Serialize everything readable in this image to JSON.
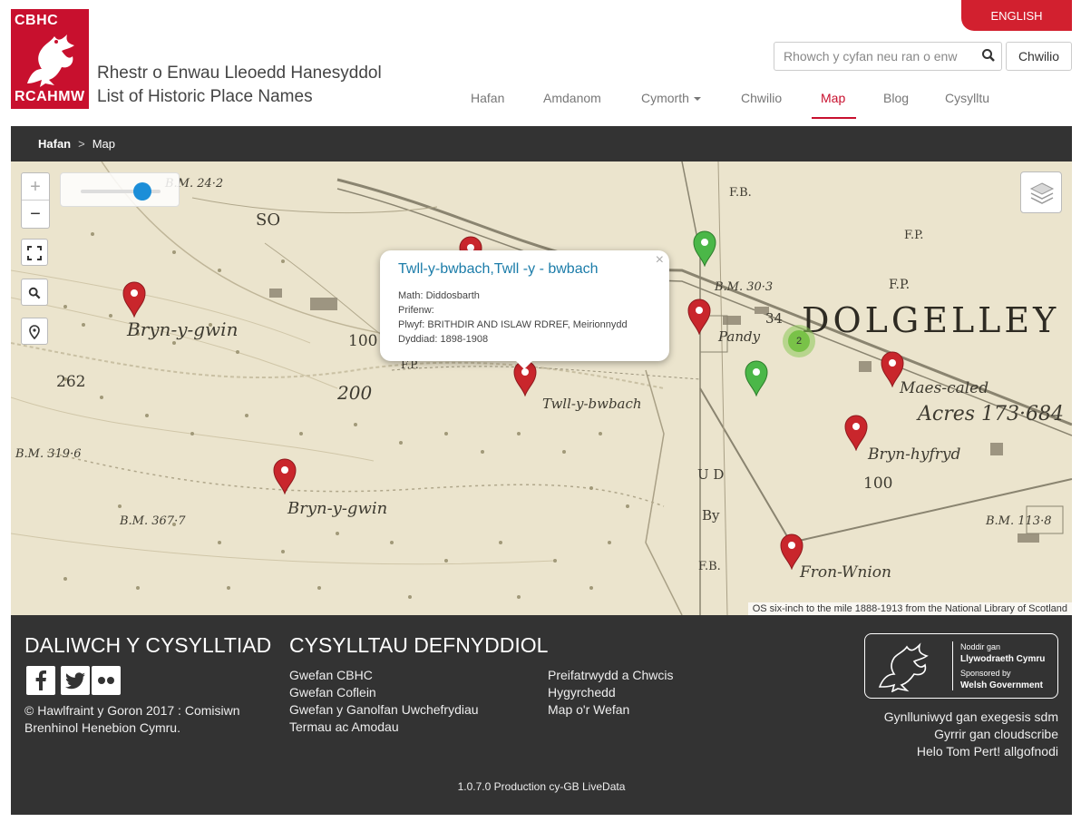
{
  "logo": {
    "top_text": "CBHC",
    "bottom_text": "RCAHMW"
  },
  "site_title": {
    "line1": "Rhestr o Enwau Lleoedd Hanesyddol",
    "line2": "List of Historic Place Names"
  },
  "language_button": "ENGLISH",
  "search": {
    "placeholder": "Rhowch y cyfan neu ran o enw",
    "button": "Chwilio"
  },
  "nav": {
    "items": [
      {
        "label": "Hafan",
        "active": false
      },
      {
        "label": "Amdanom",
        "active": false
      },
      {
        "label": "Cymorth",
        "active": false,
        "dropdown": true
      },
      {
        "label": "Chwilio",
        "active": false
      },
      {
        "label": "Map",
        "active": true
      },
      {
        "label": "Blog",
        "active": false
      },
      {
        "label": "Cysylltu",
        "active": false
      }
    ]
  },
  "breadcrumb": {
    "home": "Hafan",
    "separator": ">",
    "current": "Map"
  },
  "map": {
    "zoom_in": "+",
    "zoom_out": "−",
    "attribution": "OS six-inch to the mile 1888-1913 from the National Library of Scotland",
    "popup": {
      "title": "Twll-y-bwbach,Twll -y - bwbach",
      "close": "×",
      "rows": [
        "Math: Diddosbarth",
        "Prifenw:",
        "Plwyf: BRITHDIR AND ISLAW RDREF, Meirionnydd",
        "Dyddiad: 1898-1908"
      ]
    },
    "cluster_count": "2",
    "map_labels": {
      "bryn_y_gwin_1": "Bryn-y-gwin",
      "bryn_y_gwin_2": "Bryn-y-gwin",
      "twll_y_bwbach": "Twll-y-bwbach",
      "dolgelley": "DOLGELLEY",
      "maes_caled": "Maes-caled",
      "acres": "Acres 173·684",
      "bryn_hyfryd": "Bryn-hyfryd",
      "fron_wnion": "Fron-Wnion",
      "pandy": "Pandy",
      "bm_3193": "B.M. 319·6",
      "bm_3677": "B.M. 367·7",
      "bm_303": "B.M. 30·3",
      "bm_1133": "B.M. 113·8",
      "bm_242": "B.M. 24·2",
      "n262": "262",
      "n200": "200",
      "n100a": "100",
      "n100b": "100",
      "n34": "34",
      "fp1": "F.P.",
      "fp2": "F.P.",
      "fp3": "F.B.",
      "fp4": "F.B.",
      "fp5": "F.P.",
      "so": "SO",
      "ud": "U D",
      "by": "By"
    },
    "colors": {
      "red_marker": "#c9262c",
      "green_marker": "#4bb748"
    }
  },
  "footer": {
    "social_heading": "DALIWCH Y CYSYLLTIAD",
    "links_heading": "CYSYLLTAU DEFNYDDIOL",
    "copyright": "© Hawlfraint y Goron 2017 : Comisiwn Brenhinol Henebion Cymru.",
    "links_col1": [
      "Gwefan CBHC",
      "Gwefan Coflein",
      "Gwefan y Ganolfan Uwchefrydiau",
      "Termau ac Amodau"
    ],
    "links_col2": [
      "Preifatrwydd a Chwcis",
      "Hygyrchedd",
      "Map o'r Wefan"
    ],
    "gov_badge": {
      "line1": "Noddir gan",
      "line2": "Llywodraeth Cymru",
      "line3": "Sponsored by",
      "line4": "Welsh Government"
    },
    "credits": [
      "Gynlluniwyd gan exegesis sdm",
      "Gyrrir gan cloudscribe",
      "Helo Tom Pert! allgofnodi"
    ],
    "version": "1.0.7.0  Production  cy-GB  LiveData"
  }
}
